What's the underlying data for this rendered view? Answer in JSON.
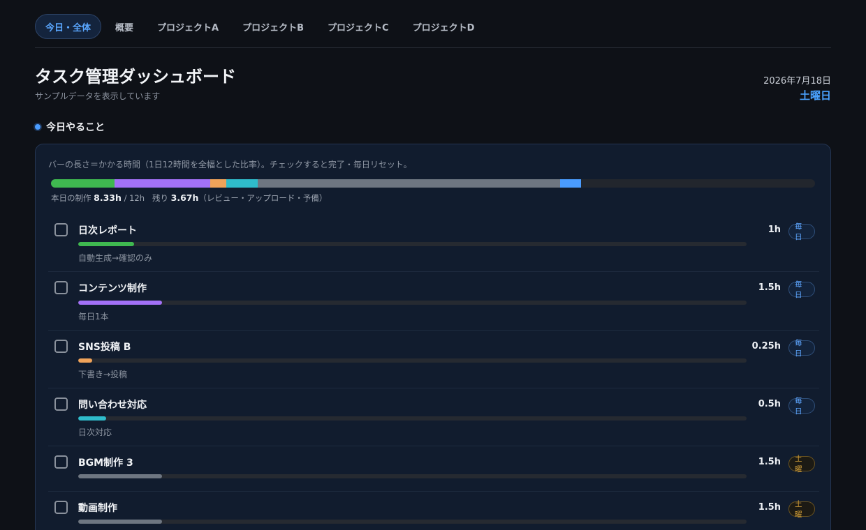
{
  "tabs": [
    {
      "label": "今日・全体",
      "active": true
    },
    {
      "label": "概要",
      "active": false
    },
    {
      "label": "プロジェクトA",
      "active": false
    },
    {
      "label": "プロジェクトB",
      "active": false
    },
    {
      "label": "プロジェクトC",
      "active": false
    },
    {
      "label": "プロジェクトD",
      "active": false
    }
  ],
  "header": {
    "title": "タスク管理ダッシュボード",
    "subtitle": "サンプルデータを表示しています",
    "date": "2026年7月18日",
    "weekday": "土曜日"
  },
  "section": {
    "title": "今日やること"
  },
  "panel": {
    "note": "バーの長さ＝かかる時間（1日12時間を全幅とした比率）。チェックすると完了・毎日リセット。",
    "summary": {
      "produce_label": "本日の制作",
      "produce_value": "8.33h",
      "total": "/ 12h",
      "remain_label": "残り",
      "remain_value": "3.67h",
      "remain_note": "（レビュー・アップロード・予備）"
    },
    "day_hours": 12,
    "stack": [
      {
        "hours": 1,
        "color": "#3fb950"
      },
      {
        "hours": 1.5,
        "color": "#a371f7"
      },
      {
        "hours": 0.25,
        "color": "#f0a35a"
      },
      {
        "hours": 0.5,
        "color": "#2fbccb"
      },
      {
        "hours": 4.75,
        "color": "#6e7681"
      },
      {
        "hours": 0.33,
        "color": "#4a9cff"
      }
    ]
  },
  "tasks": [
    {
      "name": "日次レポート",
      "hours_label": "1h",
      "hours": 1,
      "fraction": 0.0833,
      "color": "#3fb950",
      "desc": "自動生成→確認のみ",
      "badge": "毎日",
      "badge_type": "daily"
    },
    {
      "name": "コンテンツ制作",
      "hours_label": "1.5h",
      "hours": 1.5,
      "fraction": 0.125,
      "color": "#a371f7",
      "desc": "毎日1本",
      "badge": "毎日",
      "badge_type": "daily"
    },
    {
      "name": "SNS投稿 B",
      "hours_label": "0.25h",
      "hours": 0.25,
      "fraction": 0.0208,
      "color": "#f0a35a",
      "desc": "下書き→投稿",
      "badge": "毎日",
      "badge_type": "daily"
    },
    {
      "name": "問い合わせ対応",
      "hours_label": "0.5h",
      "hours": 0.5,
      "fraction": 0.0417,
      "color": "#2fbccb",
      "desc": "日次対応",
      "badge": "毎日",
      "badge_type": "daily"
    },
    {
      "name": "BGM制作 3",
      "hours_label": "1.5h",
      "hours": 1.5,
      "fraction": 0.125,
      "color": "#6e7681",
      "desc": "",
      "badge": "土曜",
      "badge_type": "sat"
    },
    {
      "name": "動画制作",
      "hours_label": "1.5h",
      "hours": 1.5,
      "fraction": 0.125,
      "color": "#6e7681",
      "desc": "",
      "badge": "土曜",
      "badge_type": "sat"
    }
  ]
}
